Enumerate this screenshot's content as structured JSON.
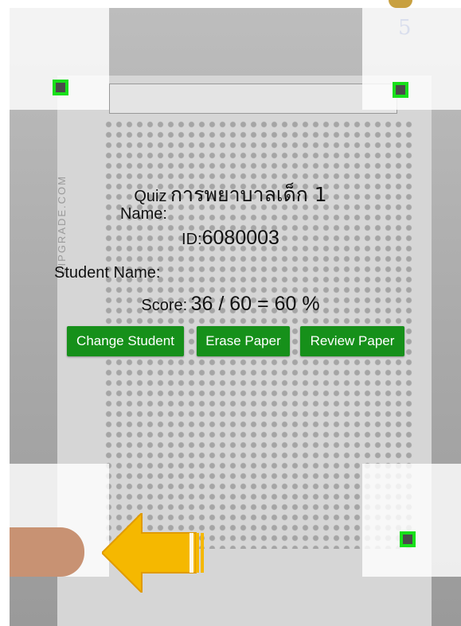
{
  "paper": {
    "page_number": "5",
    "side_text": "ZIPGRADE.COM"
  },
  "result": {
    "quiz_label": "Quiz",
    "quiz_title": "การพยาบาลเด็ก 1",
    "name_label": "Name:",
    "id_label": "ID:",
    "id_value": "6080003",
    "student_name_label": "Student Name:",
    "score_label": "Score:",
    "score_value": "36 / 60 = 60 %"
  },
  "buttons": {
    "change_student": "Change Student",
    "erase_paper": "Erase Paper",
    "review_paper": "Review Paper"
  },
  "colors": {
    "button_bg": "#16901a",
    "marker_border": "#18e01a",
    "arrow": "#f5b800"
  },
  "icons": {
    "arrow": "left-arrow-icon",
    "marker": "alignment-marker-icon"
  }
}
